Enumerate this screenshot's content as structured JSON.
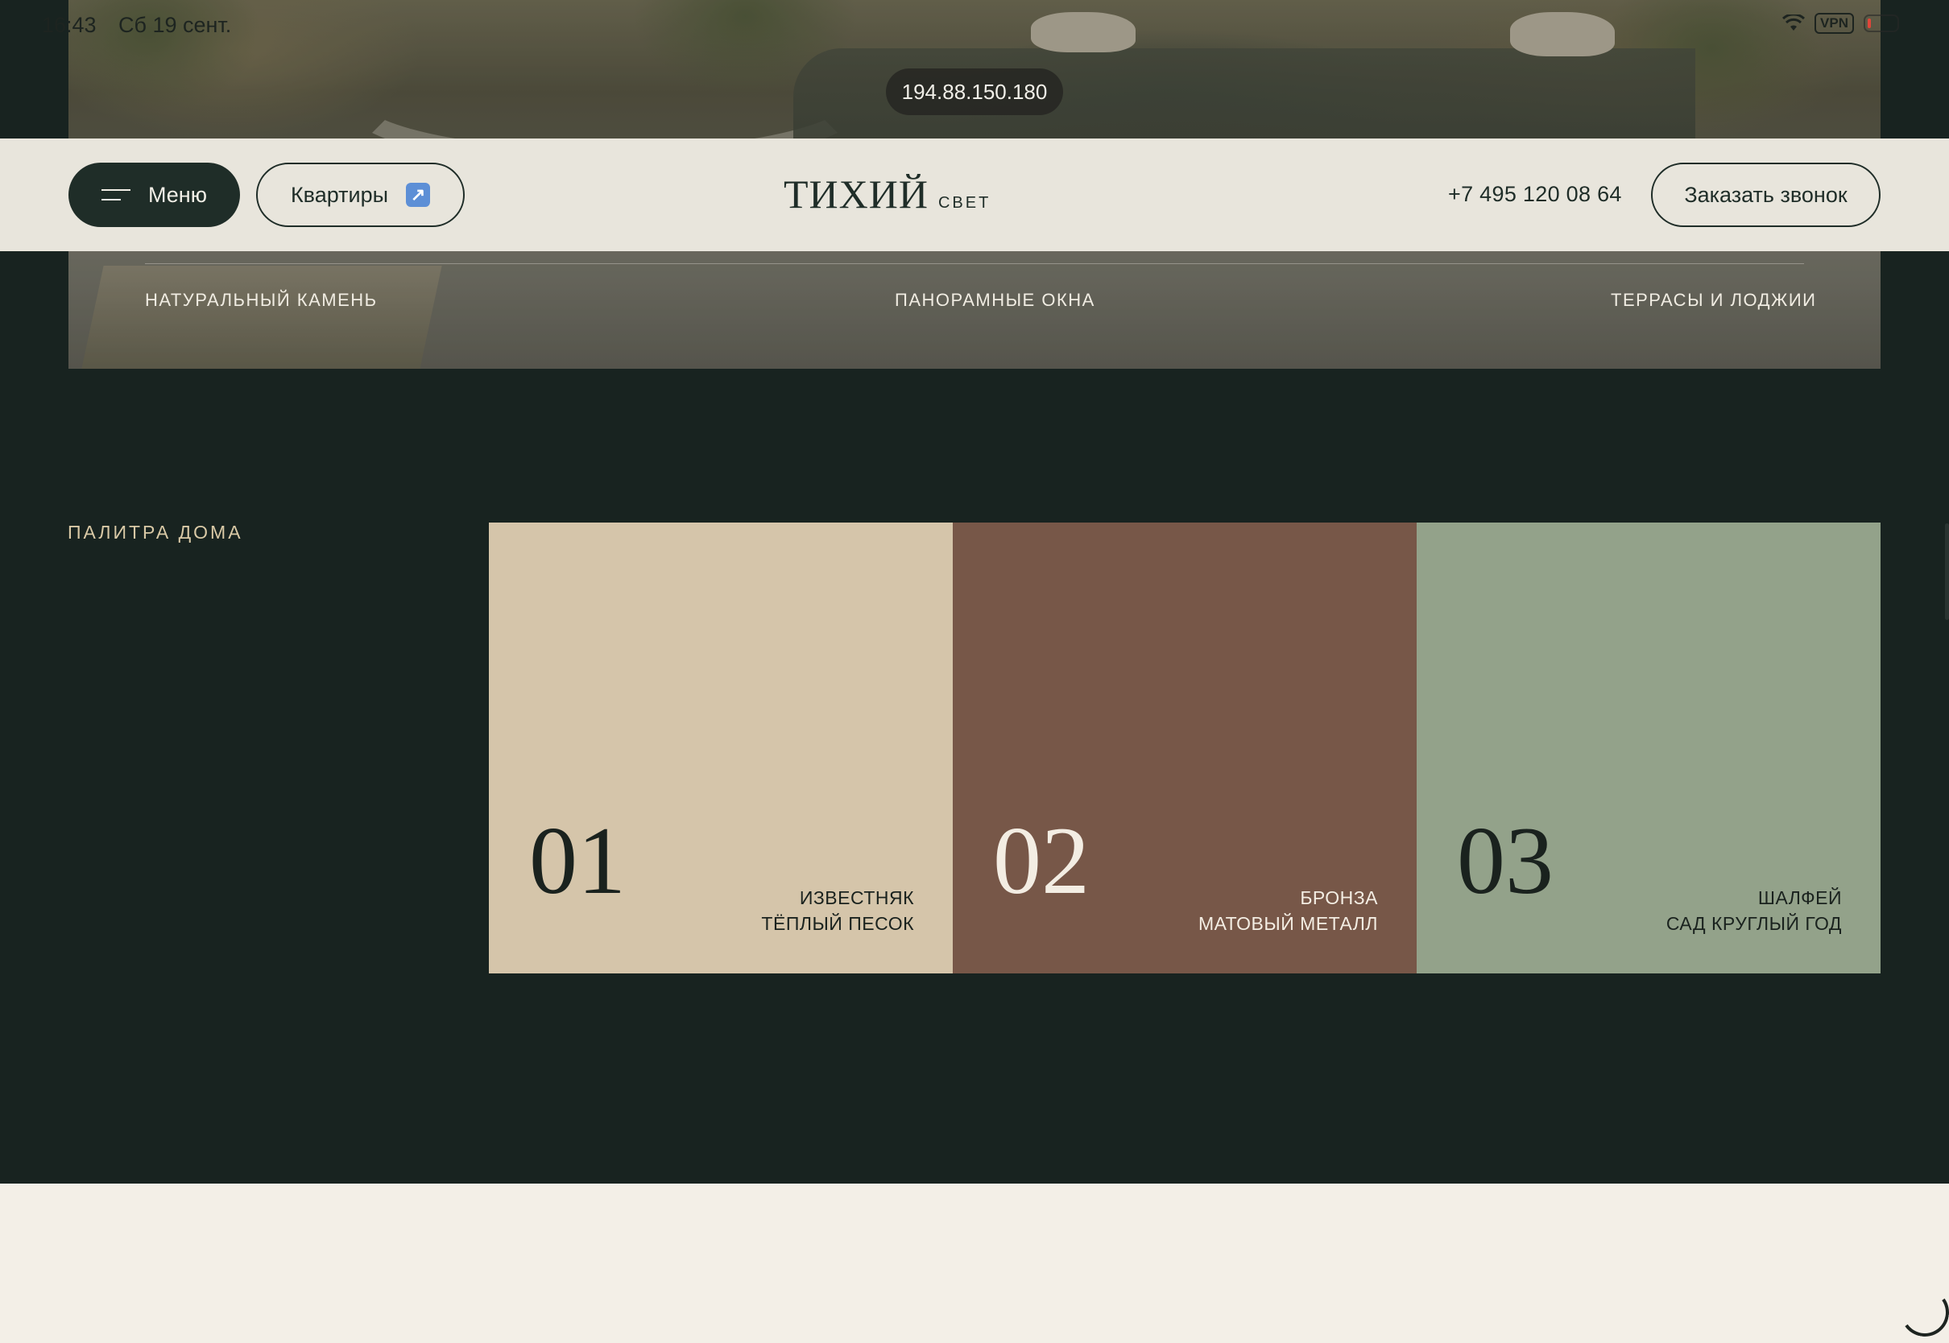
{
  "status_bar": {
    "time": "16:43",
    "date": "Сб 19 сент.",
    "vpn_label": "VPN",
    "icons": [
      "wifi-icon",
      "battery-icon"
    ]
  },
  "browser": {
    "address": "194.88.150.180"
  },
  "header": {
    "menu_label": "Меню",
    "apartments_label": "Квартиры",
    "apartments_icon": "arrow-up-right-icon",
    "logo_main": "ТИХИЙ",
    "logo_sub": "СВЕТ",
    "phone": "+7 495 120 08 64",
    "callback_label": "Заказать звонок"
  },
  "features": [
    "НАТУРАЛЬНЫЙ КАМЕНЬ",
    "ПАНОРАМНЫЕ ОКНА",
    "ТЕРРАСЫ И ЛОДЖИИ"
  ],
  "palette": {
    "label": "ПАЛИТРА ДОМА",
    "swatches": [
      {
        "number": "01",
        "line1": "ИЗВЕСТНЯК",
        "line2": "ТЁПЛЫЙ ПЕСОК",
        "color": "#d5c5aa",
        "text_color": "#1a221e"
      },
      {
        "number": "02",
        "line1": "БРОНЗА",
        "line2": "МАТОВЫЙ МЕТАЛЛ",
        "color": "#775748",
        "text_color": "#f3ede3"
      },
      {
        "number": "03",
        "line1": "ШАЛФЕЙ",
        "line2": "САД КРУГЛЫЙ ГОД",
        "color": "#93a28a",
        "text_color": "#1a221e"
      }
    ]
  },
  "colors": {
    "page_background": "#182320",
    "header_background": "#e8e5dc",
    "primary_dark": "#1f2d28",
    "accent_label": "#d9c9a6",
    "bottom_background": "#f3efe7"
  }
}
